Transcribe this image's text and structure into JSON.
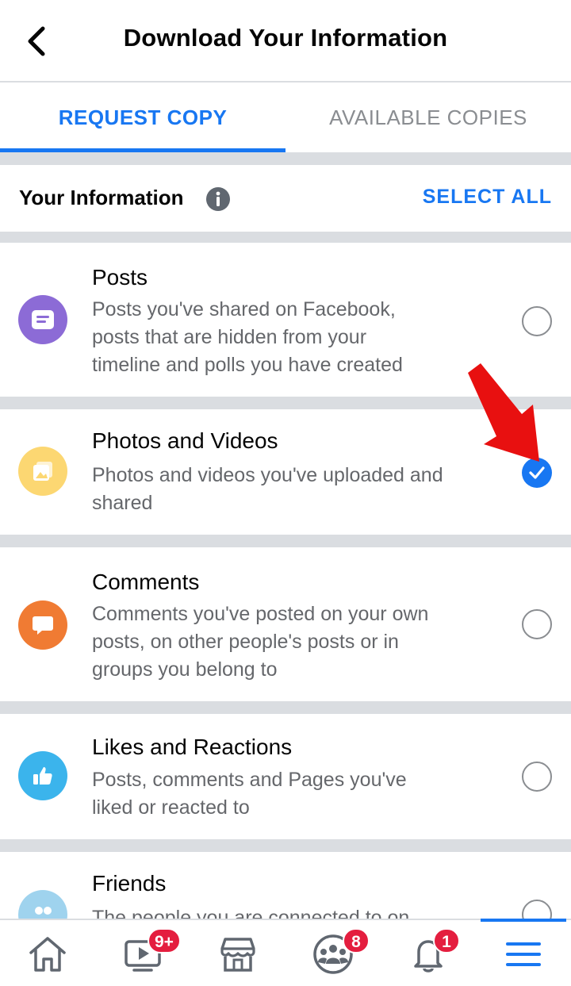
{
  "header": {
    "title": "Download Your Information",
    "back_icon": "chevron-left-icon"
  },
  "tabs": [
    {
      "label": "REQUEST COPY",
      "active": true
    },
    {
      "label": "AVAILABLE COPIES",
      "active": false
    }
  ],
  "info_row": {
    "label": "Your Information",
    "info_icon": "info-icon",
    "select_all": "SELECT ALL"
  },
  "items": [
    {
      "title": "Posts",
      "desc": [
        "Posts you've shared on Facebook,",
        "posts that are hidden from your",
        "timeline and polls you have created"
      ],
      "icon": "post-icon",
      "icon_color": "#8c6bd6",
      "checked": false
    },
    {
      "title": "Photos and Videos",
      "desc": [
        "Photos and videos you've uploaded and",
        "shared"
      ],
      "icon": "photos-icon",
      "icon_color": "#fcd772",
      "checked": true
    },
    {
      "title": "Comments",
      "desc": [
        "Comments you've posted on your own",
        "posts, on other people's posts or in",
        "groups you belong to"
      ],
      "icon": "comment-icon",
      "icon_color": "#f07b33",
      "checked": false
    },
    {
      "title": "Likes and Reactions",
      "desc": [
        "Posts, comments and Pages you've",
        "liked or reacted to"
      ],
      "icon": "thumbs-up-icon",
      "icon_color": "#3bb4ec",
      "checked": false
    },
    {
      "title": "Friends",
      "desc": [
        "The people you are connected to on"
      ],
      "icon": "friends-icon",
      "icon_color": "#9fd3ee",
      "checked": false
    }
  ],
  "bottom_nav": [
    {
      "name": "home-icon",
      "badge": ""
    },
    {
      "name": "watch-icon",
      "badge": "9+"
    },
    {
      "name": "marketplace-icon",
      "badge": ""
    },
    {
      "name": "groups-icon",
      "badge": "8"
    },
    {
      "name": "notifications-icon",
      "badge": "1"
    },
    {
      "name": "menu-icon",
      "badge": ""
    }
  ],
  "colors": {
    "accent": "#1877f2",
    "badge": "#e41e3f",
    "annotation_arrow": "#e81010"
  }
}
